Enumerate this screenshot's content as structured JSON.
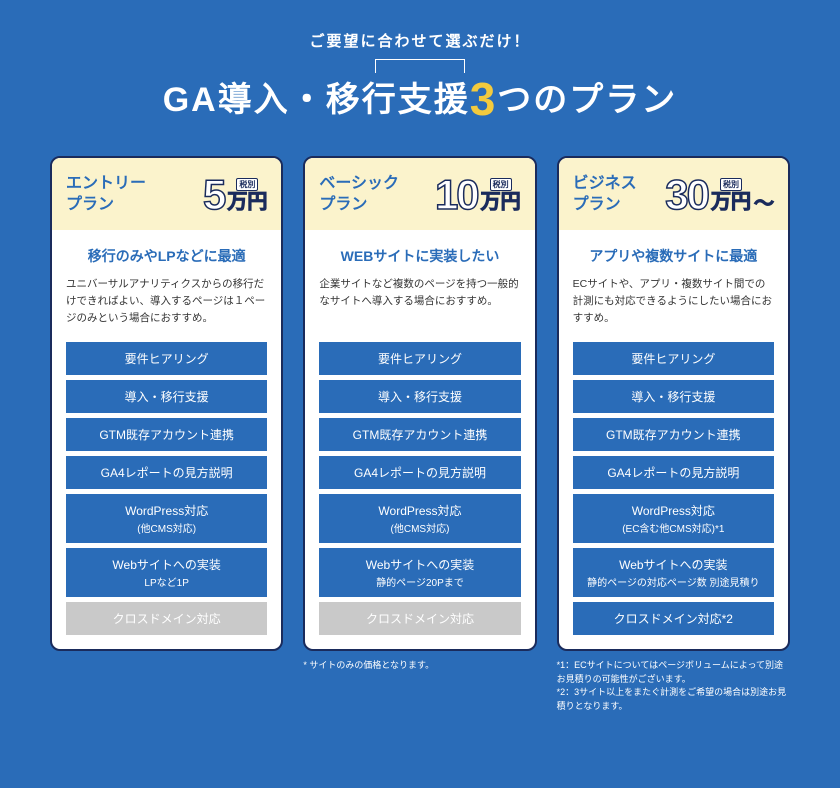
{
  "header": {
    "subtitle": "ご要望に合わせて選ぶだけ！",
    "title_prefix": "GA導入・移行支援",
    "title_number": "3",
    "title_suffix": "つのプラン"
  },
  "plans": [
    {
      "name": "エントリー\nプラン",
      "price_num": "5",
      "tax": "税別",
      "price_unit": "万円",
      "price_suffix": "",
      "heading": "移行のみやLPなどに最適",
      "desc": "ユニバーサルアナリティクスからの移行だけできればよい、導入するページは１ページのみという場合におすすめ。",
      "features": [
        {
          "label": "要件ヒアリング",
          "sub": "",
          "disabled": false
        },
        {
          "label": "導入・移行支援",
          "sub": "",
          "disabled": false
        },
        {
          "label": "GTM既存アカウント連携",
          "sub": "",
          "disabled": false
        },
        {
          "label": "GA4レポートの見方説明",
          "sub": "",
          "disabled": false
        },
        {
          "label": "WordPress対応",
          "sub": "(他CMS対応)",
          "disabled": false
        },
        {
          "label": "Webサイトへの実装",
          "sub": "LPなど1P",
          "disabled": false
        },
        {
          "label": "クロスドメイン対応",
          "sub": "",
          "disabled": true
        }
      ],
      "footnote": ""
    },
    {
      "name": "ベーシック\nプラン",
      "price_num": "10",
      "tax": "税別",
      "price_unit": "万円",
      "price_suffix": "",
      "heading": "WEBサイトに実装したい",
      "desc": "企業サイトなど複数のページを持つ一般的なサイトへ導入する場合におすすめ。",
      "features": [
        {
          "label": "要件ヒアリング",
          "sub": "",
          "disabled": false
        },
        {
          "label": "導入・移行支援",
          "sub": "",
          "disabled": false
        },
        {
          "label": "GTM既存アカウント連携",
          "sub": "",
          "disabled": false
        },
        {
          "label": "GA4レポートの見方説明",
          "sub": "",
          "disabled": false
        },
        {
          "label": "WordPress対応",
          "sub": "(他CMS対応)",
          "disabled": false
        },
        {
          "label": "Webサイトへの実装",
          "sub": "静的ページ20Pまで",
          "disabled": false
        },
        {
          "label": "クロスドメイン対応",
          "sub": "",
          "disabled": true
        }
      ],
      "footnote": "* サイトのみの価格となります。"
    },
    {
      "name": "ビジネス\nプラン",
      "price_num": "30",
      "tax": "税別",
      "price_unit": "万円",
      "price_suffix": "〜",
      "heading": "アプリや複数サイトに最適",
      "desc": "ECサイトや、アプリ・複数サイト間での計測にも対応できるようにしたい場合におすすめ。",
      "features": [
        {
          "label": "要件ヒアリング",
          "sub": "",
          "disabled": false
        },
        {
          "label": "導入・移行支援",
          "sub": "",
          "disabled": false
        },
        {
          "label": "GTM既存アカウント連携",
          "sub": "",
          "disabled": false
        },
        {
          "label": "GA4レポートの見方説明",
          "sub": "",
          "disabled": false
        },
        {
          "label": "WordPress対応",
          "sub": "(EC含む他CMS対応)*1",
          "disabled": false
        },
        {
          "label": "Webサイトへの実装",
          "sub": "静的ページの対応ページ数 別途見積り",
          "disabled": false
        },
        {
          "label": "クロスドメイン対応*2",
          "sub": "",
          "disabled": false
        }
      ],
      "footnote": "*1：ECサイトについてはページボリュームによって別途お見積りの可能性がございます。\n*2：3サイト以上をまたぐ計測をご希望の場合は別途お見積りとなります。"
    }
  ]
}
